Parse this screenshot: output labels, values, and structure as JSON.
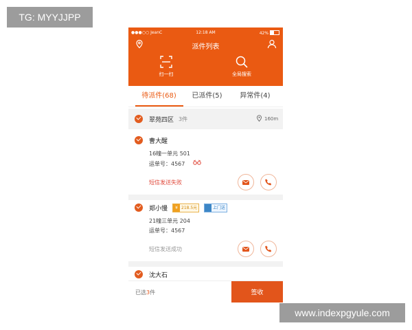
{
  "watermarks": {
    "top_left": "TG: MYYJJPP",
    "bottom_right": "www.indexpgyule.com"
  },
  "status_bar": {
    "carrier": "●●●○○ JeanC",
    "time": "12:18 AM",
    "battery": "42%"
  },
  "nav": {
    "title": "派件列表",
    "left_icon": "location-icon",
    "right_icon": "user-icon"
  },
  "actions": {
    "scan_label": "扫一扫",
    "search_label": "全局搜索"
  },
  "tabs": [
    {
      "label": "待派件(68)",
      "active": true
    },
    {
      "label": "已派件(5)",
      "active": false
    },
    {
      "label": "异常件(4)",
      "active": false
    }
  ],
  "group": {
    "name": "翠苑四区",
    "count": "3件",
    "distance": "160m"
  },
  "items": [
    {
      "name": "曹大醒",
      "address": "16幢一单元 501",
      "waybill": "运单号：4567",
      "sms_status": "短信发送失败",
      "sms_color": "#e0483a"
    },
    {
      "name": "郑小慢",
      "price_badge": "218.5元",
      "door_badge": "上门送",
      "address": "21幢三单元 204",
      "waybill": "运单号：4567",
      "sms_status": "短信发送成功",
      "sms_color": "#999999"
    },
    {
      "name": "沈大石"
    }
  ],
  "footer": {
    "selected_prefix": "已选",
    "selected_count": "3",
    "selected_suffix": "件",
    "sign_label": "签收"
  },
  "colors": {
    "brand": "#ea5a12",
    "accent": "#e2551b"
  }
}
